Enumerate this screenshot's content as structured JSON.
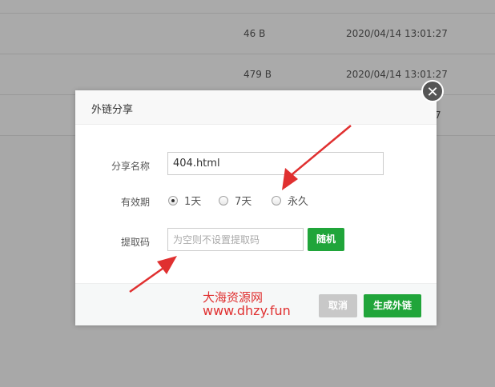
{
  "background_table": {
    "rows": [
      {
        "size": "46 B",
        "modified": "2020/04/14 13:01:27"
      },
      {
        "size": "479 B",
        "modified": "2020/04/14 13:01:27"
      },
      {
        "size": "",
        "modified": "7"
      }
    ]
  },
  "dialog": {
    "title": "外链分享",
    "close_icon": "close-icon",
    "fields": {
      "share_name_label": "分享名称",
      "share_name_value": "404.html",
      "validity_label": "有效期",
      "validity_options": [
        "1天",
        "7天",
        "永久"
      ],
      "validity_selected": "1天",
      "extract_code_label": "提取码",
      "extract_code_placeholder": "为空则不设置提取码",
      "random_button": "随机"
    },
    "footer": {
      "cancel_button": "取消",
      "generate_button": "生成外链"
    }
  },
  "watermark": {
    "line1": "大海资源网",
    "line2": "www.dhzy.fun"
  },
  "colors": {
    "accent_green": "#20a53a",
    "annotation_red": "#e03030",
    "overlay_gray": "#a8a8a8"
  }
}
